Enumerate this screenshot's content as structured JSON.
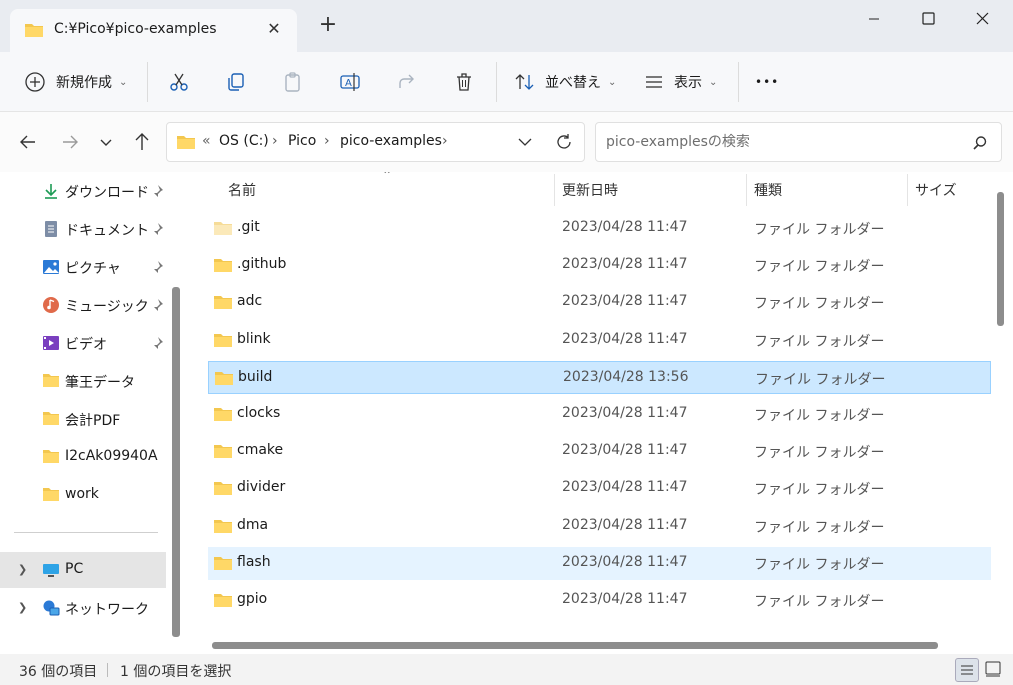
{
  "window": {
    "tab_title": "C:¥Pico¥pico-examples",
    "new_tab": "+"
  },
  "toolbar": {
    "new_label": "新規作成",
    "sort_label": "並べ替え",
    "view_label": "表示",
    "more_label": "•••"
  },
  "address": {
    "overflow": "«",
    "crumbs": [
      "OS (C:)",
      "Pico",
      "pico-examples"
    ],
    "search_placeholder": "pico-examplesの検索"
  },
  "sidebar": {
    "items": [
      {
        "label": "ダウンロード",
        "icon": "download-icon",
        "pinned": true
      },
      {
        "label": "ドキュメント",
        "icon": "document-icon",
        "pinned": true
      },
      {
        "label": "ピクチャ",
        "icon": "pictures-icon",
        "pinned": true
      },
      {
        "label": "ミュージック",
        "icon": "music-icon",
        "pinned": true
      },
      {
        "label": "ビデオ",
        "icon": "video-icon",
        "pinned": true
      },
      {
        "label": "筆王データ",
        "icon": "folder-icon",
        "pinned": false
      },
      {
        "label": "会計PDF",
        "icon": "folder-icon",
        "pinned": false
      },
      {
        "label": "I2cAk09940A",
        "icon": "folder-icon",
        "pinned": false
      },
      {
        "label": "work",
        "icon": "folder-icon",
        "pinned": false
      }
    ],
    "pc_label": "PC",
    "network_label": "ネットワーク"
  },
  "list": {
    "columns": {
      "name": "名前",
      "date": "更新日時",
      "type": "種類",
      "size": "サイズ"
    },
    "rows": [
      {
        "name": ".git",
        "date": "2023/04/28 11:47",
        "type": "ファイル フォルダー"
      },
      {
        "name": ".github",
        "date": "2023/04/28 11:47",
        "type": "ファイル フォルダー"
      },
      {
        "name": "adc",
        "date": "2023/04/28 11:47",
        "type": "ファイル フォルダー"
      },
      {
        "name": "blink",
        "date": "2023/04/28 11:47",
        "type": "ファイル フォルダー"
      },
      {
        "name": "build",
        "date": "2023/04/28 13:56",
        "type": "ファイル フォルダー"
      },
      {
        "name": "clocks",
        "date": "2023/04/28 11:47",
        "type": "ファイル フォルダー"
      },
      {
        "name": "cmake",
        "date": "2023/04/28 11:47",
        "type": "ファイル フォルダー"
      },
      {
        "name": "divider",
        "date": "2023/04/28 11:47",
        "type": "ファイル フォルダー"
      },
      {
        "name": "dma",
        "date": "2023/04/28 11:47",
        "type": "ファイル フォルダー"
      },
      {
        "name": "flash",
        "date": "2023/04/28 11:47",
        "type": "ファイル フォルダー"
      },
      {
        "name": "gpio",
        "date": "2023/04/28 11:47",
        "type": "ファイル フォルダー"
      }
    ],
    "selected": "build",
    "hovered": "flash"
  },
  "status": {
    "item_count": "36 個の項目",
    "selected_count": "1 個の項目を選択"
  },
  "colors": {
    "folder": "#f3c74f",
    "selection": "#cce8ff",
    "hover": "#e5f3ff"
  }
}
